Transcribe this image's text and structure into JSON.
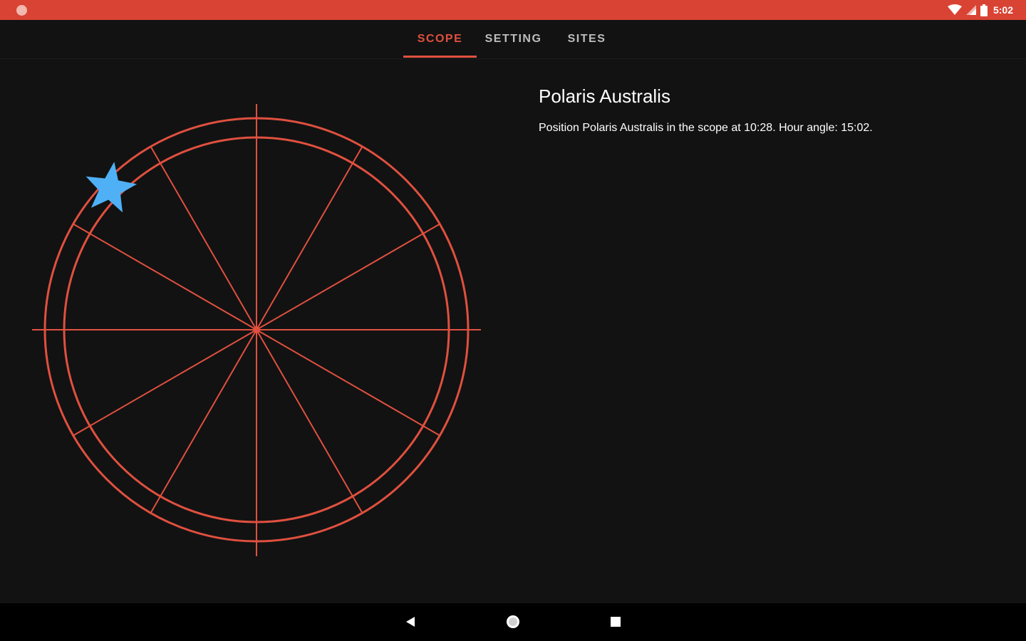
{
  "status_bar": {
    "time": "5:02",
    "color": "#d94333",
    "icons": [
      "app-notification-icon",
      "wifi-icon",
      "cell-signal-icon",
      "battery-icon"
    ]
  },
  "tabs": [
    {
      "label": "SCOPE",
      "active": true
    },
    {
      "label": "SETTING",
      "active": false
    },
    {
      "label": "SITES",
      "active": false
    }
  ],
  "accent_color": "#e0503f",
  "star_color": "#4fb0f5",
  "info": {
    "title": "Polaris Australis",
    "description": "Position Polaris Australis in the scope at 10:28. Hour angle: 15:02."
  },
  "reticle": {
    "spokes": 12,
    "target": "star-icon",
    "target_clock_position": "10:28"
  },
  "nav_bar": {
    "icons": [
      "back-icon",
      "home-icon",
      "recents-icon"
    ]
  }
}
